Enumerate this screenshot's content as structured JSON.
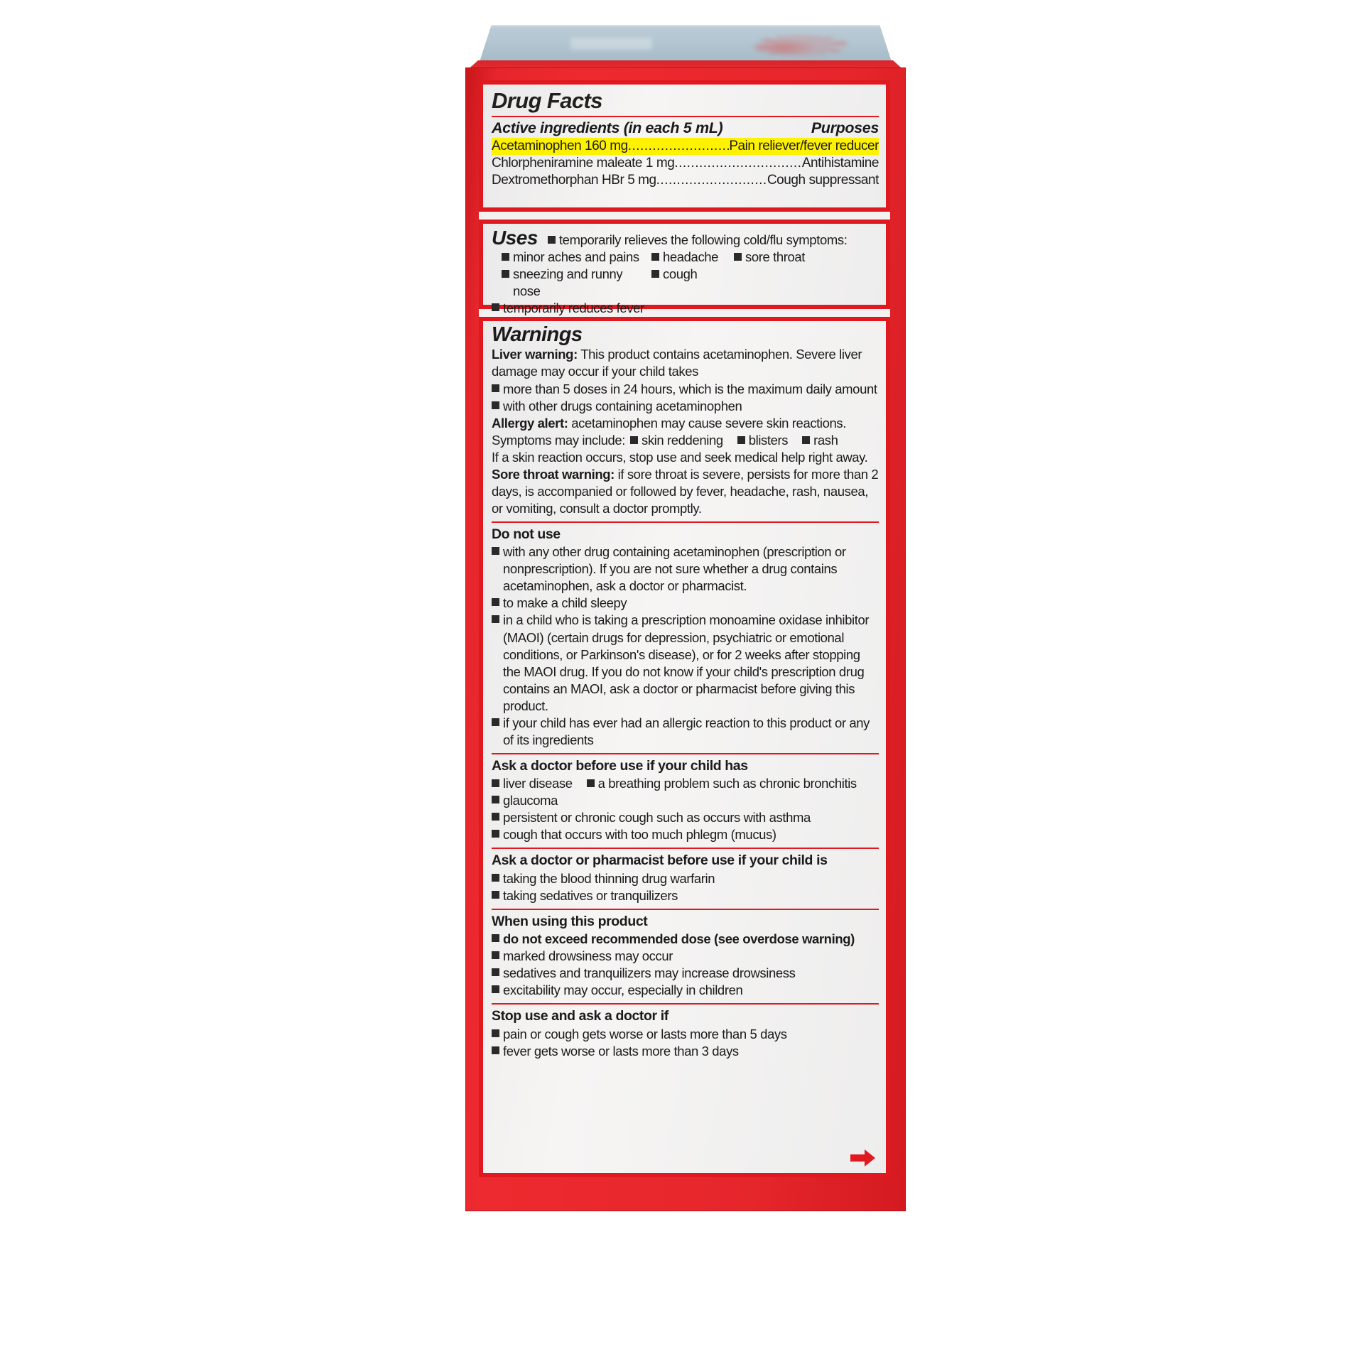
{
  "label": {
    "title": "Drug Facts",
    "active_ingredients_header": "Active ingredients (in each 5 mL)",
    "purposes_header": "Purposes",
    "ingredients": [
      {
        "name": "Acetaminophen 160 mg",
        "dots": ".......................................",
        "purpose": "Pain reliever/fever reducer",
        "highlight": true,
        "highlight_color": "#fff200"
      },
      {
        "name": "Chlorpheniramine maleate 1 mg",
        "dots": "..............................................",
        "purpose": "Antihistamine",
        "highlight": false
      },
      {
        "name": "Dextromethorphan HBr 5 mg",
        "dots": ".......................................",
        "purpose": "Cough suppressant",
        "highlight": false
      }
    ],
    "uses": {
      "title": "Uses",
      "lead": "temporarily relieves the following cold/flu symptoms:",
      "row1": [
        "minor aches and pains",
        "headache",
        "sore throat"
      ],
      "row2": [
        "sneezing and runny nose",
        "cough"
      ],
      "last": "temporarily reduces fever"
    },
    "warnings": {
      "title": "Warnings",
      "liver_label": "Liver warning:",
      "liver_text": " This product contains acetaminophen. Severe liver damage may occur if your child takes",
      "liver_bullets": [
        "more than 5 doses in 24 hours, which is the maximum daily amount",
        "with other drugs containing acetaminophen"
      ],
      "allergy_label": "Allergy alert:",
      "allergy_text": " acetaminophen may cause severe skin reactions.",
      "symptoms_lead": "Symptoms may include:",
      "symptoms": [
        "skin reddening",
        "blisters",
        "rash"
      ],
      "skin_reaction_text": "If a skin reaction occurs, stop use and seek medical help right away.",
      "sore_throat_label": "Sore throat warning:",
      "sore_throat_text": " if sore throat is severe, persists for more than 2 days, is accompanied or followed by fever, headache, rash, nausea, or vomiting, consult a doctor promptly.",
      "do_not_use_head": "Do not use",
      "do_not_use_items": [
        "with any other drug containing acetaminophen (prescription or nonprescription). If you are not sure whether a drug contains acetaminophen, ask a doctor or pharmacist.",
        "to make a child sleepy",
        "in a child who is taking a prescription monoamine oxidase inhibitor (MAOI) (certain drugs for depression, psychiatric or emotional conditions, or Parkinson's disease), or for 2 weeks after stopping the MAOI drug. If you do not know if your child's prescription drug contains an MAOI, ask a  doctor or pharmacist before giving this product.",
        "if your child has ever had an allergic reaction to this product or any of its ingredients"
      ],
      "ask_doctor_head": "Ask a doctor before use if your child has",
      "ask_doctor_inline": [
        "liver disease",
        "a breathing problem such as chronic bronchitis"
      ],
      "ask_doctor_items": [
        "glaucoma",
        "persistent or chronic cough such as occurs with asthma",
        "cough that occurs with too much phlegm (mucus)"
      ],
      "ask_pharmacist_head": "Ask a doctor or pharmacist before use if your child is",
      "ask_pharmacist_items": [
        "taking the blood thinning drug warfarin",
        "taking sedatives or tranquilizers"
      ],
      "when_using_head": "When using this product",
      "when_using_bold": "do not exceed recommended dose (see overdose warning)",
      "when_using_items": [
        "marked drowsiness may occur",
        "sedatives and tranquilizers may increase drowsiness",
        "excitability may occur, especially in children"
      ],
      "stop_use_head": "Stop use and ask a doctor if",
      "stop_use_items": [
        "pain or cough gets worse or lasts more than 5 days",
        "fever gets worse or lasts more than 3 days"
      ]
    },
    "colors": {
      "brand_red": "#e0181f",
      "carton_red": "#ed2a2f",
      "highlight_yellow": "#fff200",
      "panel_gray": "#f0efee",
      "text_black": "#1b1b1b"
    }
  }
}
